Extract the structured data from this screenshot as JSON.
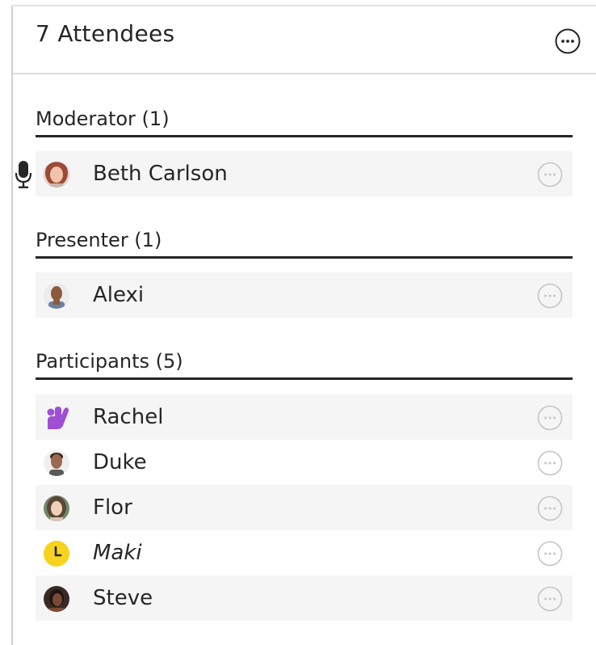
{
  "header": {
    "title": "7 Attendees"
  },
  "sections": {
    "moderator": {
      "label": "Moderator (1)"
    },
    "presenter": {
      "label": "Presenter (1)"
    },
    "participants": {
      "label": "Participants (5)"
    }
  },
  "attendees": {
    "beth": {
      "name": "Beth Carlson",
      "status": "speaking",
      "avatar": "photo-avatar"
    },
    "alexi": {
      "name": "Alexi",
      "avatar": "photo-avatar"
    },
    "rachel": {
      "name": "Rachel",
      "status": "hand-raised",
      "avatar": "raised-hand-icon"
    },
    "duke": {
      "name": "Duke",
      "avatar": "photo-avatar"
    },
    "flor": {
      "name": "Flor",
      "avatar": "photo-avatar"
    },
    "maki": {
      "name": "Maki",
      "status": "away",
      "avatar": "away-clock-icon"
    },
    "steve": {
      "name": "Steve",
      "avatar": "photo-avatar"
    }
  },
  "colors": {
    "hand_raised": "#9e4fd6",
    "away": "#f7d21e",
    "divider": "#262626",
    "row_shade": "#f5f5f5"
  }
}
